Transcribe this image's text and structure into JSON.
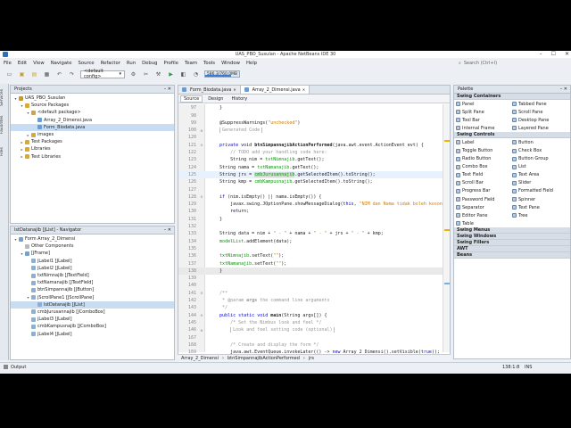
{
  "window": {
    "title": "UAS_PBO_Susulan - Apache NetBeans IDE 30"
  },
  "menu": [
    "File",
    "Edit",
    "View",
    "Navigate",
    "Source",
    "Refactor",
    "Run",
    "Debug",
    "Profile",
    "Team",
    "Tools",
    "Window",
    "Help"
  ],
  "search": {
    "placeholder": "Search (Ctrl+I)"
  },
  "toolbar": {
    "config": "<default config>",
    "memory": "586.3/760.0MB",
    "memory_fraction": 0.77
  },
  "projects": {
    "tab": "Projects",
    "nodes": [
      {
        "label": "UAS_PBO_Susulan",
        "depth": 0,
        "exp": "▾",
        "color": "#c59a2d"
      },
      {
        "label": "Source Packages",
        "depth": 1,
        "exp": "▾",
        "color": "#d6a93b"
      },
      {
        "label": "<default package>",
        "depth": 2,
        "exp": "▾",
        "color": "#c7a455"
      },
      {
        "label": "Array_2_Dimensi.java",
        "depth": 3,
        "exp": "",
        "color": "#6c9bd2"
      },
      {
        "label": "Form_Biodata.java",
        "depth": 3,
        "exp": "",
        "color": "#6c9bd2",
        "selected": true
      },
      {
        "label": "images",
        "depth": 2,
        "exp": "▸",
        "color": "#d6a93b"
      },
      {
        "label": "Test Packages",
        "depth": 1,
        "exp": "▸",
        "color": "#d6a93b"
      },
      {
        "label": "Libraries",
        "depth": 1,
        "exp": "▸",
        "color": "#d6a93b"
      },
      {
        "label": "Test Libraries",
        "depth": 1,
        "exp": "▸",
        "color": "#d6a93b"
      }
    ]
  },
  "navigator": {
    "tab": "lstDatanajib [JList] - Navigator",
    "nodes": [
      {
        "label": "Form Array_2_Dimensi",
        "depth": 0,
        "exp": "▾",
        "color": "#7aa0c8"
      },
      {
        "label": "Other Components",
        "depth": 1,
        "exp": "",
        "color": "#b9b9b9"
      },
      {
        "label": "[JFrame]",
        "depth": 1,
        "exp": "▾",
        "color": "#7aa0c8"
      },
      {
        "label": "jLabel1 [JLabel]",
        "depth": 2,
        "exp": "",
        "color": "#8bb0d8"
      },
      {
        "label": "jLabel2 [JLabel]",
        "depth": 2,
        "exp": "",
        "color": "#8bb0d8"
      },
      {
        "label": "txtNimnajib [JTextField]",
        "depth": 2,
        "exp": "",
        "color": "#8bb0d8"
      },
      {
        "label": "txtNamanajib [JTextField]",
        "depth": 2,
        "exp": "",
        "color": "#8bb0d8"
      },
      {
        "label": "btnSimpannajib [JButton]",
        "depth": 2,
        "exp": "",
        "color": "#8bb0d8"
      },
      {
        "label": "jScrollPane1 [JScrollPane]",
        "depth": 2,
        "exp": "▾",
        "color": "#8bb0d8"
      },
      {
        "label": "lstDatanajib [JList]",
        "depth": 3,
        "exp": "",
        "color": "#8bb0d8",
        "selected": true
      },
      {
        "label": "cmbJurusannajib [JComboBox]",
        "depth": 2,
        "exp": "",
        "color": "#8bb0d8"
      },
      {
        "label": "jLabel3 [JLabel]",
        "depth": 2,
        "exp": "",
        "color": "#8bb0d8"
      },
      {
        "label": "cmbKampusnajib [JComboBox]",
        "depth": 2,
        "exp": "",
        "color": "#8bb0d8"
      },
      {
        "label": "jLabel4 [JLabel]",
        "depth": 2,
        "exp": "",
        "color": "#8bb0d8"
      }
    ]
  },
  "side_tabs": [
    "Services",
    "Favorites",
    "Files"
  ],
  "editor": {
    "tabs": [
      {
        "label": "Form_Biodata.java",
        "active": false
      },
      {
        "label": "Array_2_Dimensi.java",
        "active": true
      }
    ],
    "modes": [
      "Source",
      "Design",
      "History"
    ],
    "lines": [
      {
        "n": "97",
        "f": "",
        "html": "    }"
      },
      {
        "n": "98",
        "f": "",
        "html": ""
      },
      {
        "n": "99",
        "f": "",
        "html": "    @SuppressWarnings(<span class='st'>\"unchecked\"</span>)"
      },
      {
        "n": "100",
        "f": "+",
        "html": "    <span class='cm' style='border:1px solid #bbb;padding:0 2px'>Generated Code</span>"
      },
      {
        "n": "120",
        "f": "",
        "html": ""
      },
      {
        "n": "121",
        "f": "-",
        "html": "    <span class='kw'>private void</span> <b>btnSimpannajibActionPerformed</b>(java.awt.event.ActionEvent evt) {"
      },
      {
        "n": "122",
        "f": "",
        "html": "        <span class='cm'>// TODO add your handling code here:</span>"
      },
      {
        "n": "123",
        "f": "",
        "html": "        String nim = <span class='fld'>txtNimnajib</span>.getText();"
      },
      {
        "n": "124",
        "f": "",
        "html": "    String nama = <span class='fld'>txtNamanajib</span>.getText();"
      },
      {
        "n": "125",
        "f": "",
        "html": "    String jrs = <span class='fld' style='background:#d8d8d8'>cmbJurusannajib</span>.getSelectedItem().toString();",
        "hl": true
      },
      {
        "n": "126",
        "f": "",
        "html": "    String kmp = <span class='fld'>cmbKampusnajib</span>.getSelectedItem().toString();"
      },
      {
        "n": "127",
        "f": "",
        "html": ""
      },
      {
        "n": "128",
        "f": "-",
        "html": "    <span class='kw'>if</span> (nim.isEmpty() || nama.isEmpty()) {"
      },
      {
        "n": "129",
        "f": "",
        "html": "        javax.swing.JOptionPane.showMessageDialog(<span class='kw'>this</span>, <span class='st'>\"NIM dan Nama tidak boleh kosong\"</span>);"
      },
      {
        "n": "130",
        "f": "",
        "html": "        <span class='kw'>return</span>;"
      },
      {
        "n": "131",
        "f": "",
        "html": "    }"
      },
      {
        "n": "132",
        "f": "",
        "html": ""
      },
      {
        "n": "133",
        "f": "",
        "html": "    String data = nim + <span class='st'>\" - \"</span> + nama + <span class='st'>\" - \"</span> + jrs + <span class='st'>\" - \"</span> + kmp;"
      },
      {
        "n": "134",
        "f": "",
        "html": "    <span class='fld'>modelList</span>.addElement(data);"
      },
      {
        "n": "135",
        "f": "",
        "html": ""
      },
      {
        "n": "136",
        "f": "",
        "html": "    <span class='fld'>txtNimnajib</span>.setText(<span class='st'>\"\"</span>);"
      },
      {
        "n": "137",
        "f": "",
        "html": "    <span class='fld'>txtNamanajib</span>.setText(<span class='st'>\"\"</span>);"
      },
      {
        "n": "138",
        "f": "",
        "html": "    }",
        "cur": true
      },
      {
        "n": "139",
        "f": "",
        "html": ""
      },
      {
        "n": "140",
        "f": "",
        "html": ""
      },
      {
        "n": "141",
        "f": "-",
        "html": "    <span class='cm'>/**</span>"
      },
      {
        "n": "142",
        "f": "",
        "html": "    <span class='cm'> * @param <b>args</b> the command line arguments</span>"
      },
      {
        "n": "143",
        "f": "",
        "html": "    <span class='cm'> */</span>"
      },
      {
        "n": "144",
        "f": "-",
        "html": "    <span class='kw'>public static void</span> <b>main</b>(String args[]) {"
      },
      {
        "n": "145",
        "f": "",
        "html": "        <span class='cm'>/* Set the Nimbus look and feel */</span>"
      },
      {
        "n": "146",
        "f": "+",
        "html": "        <span class='cm' style='border:1px solid #bbb;padding:0 2px'>Look and feel setting code (optional)</span>"
      },
      {
        "n": "167",
        "f": "",
        "html": ""
      },
      {
        "n": "168",
        "f": "",
        "html": "        <span class='cm'>/* Create and display the form */</span>"
      },
      {
        "n": "169",
        "f": "",
        "html": "        java.awt.EventQueue.invokeLater(() -&gt; <span class='kw'>new</span> Array_2_Dimensi().setVisible(<span class='kw'>true</span>));"
      }
    ]
  },
  "palette": {
    "tab": "Palette",
    "groups": [
      {
        "name": "Swing Containers",
        "items": [
          "Panel",
          "Tabbed Pane",
          "Split Pane",
          "Scroll Pane",
          "Tool Bar",
          "Desktop Pane",
          "Internal Frame",
          "Layered Pane"
        ]
      },
      {
        "name": "Swing Controls",
        "items": [
          "Label",
          "Button",
          "Toggle Button",
          "Check Box",
          "Radio Button",
          "Button Group",
          "Combo Box",
          "List",
          "Text Field",
          "Text Area",
          "Scroll Bar",
          "Slider",
          "Progress Bar",
          "Formatted Field",
          "Password Field",
          "Spinner",
          "Separator",
          "Text Pane",
          "Editor Pane",
          "Tree",
          "Table"
        ]
      },
      {
        "name": "Swing Menus",
        "items": []
      },
      {
        "name": "Swing Windows",
        "items": []
      },
      {
        "name": "Swing Fillers",
        "items": []
      },
      {
        "name": "AWT",
        "items": []
      },
      {
        "name": "Beans",
        "items": []
      }
    ]
  },
  "breadcrumb": [
    "Array_2_Dimensi",
    "btnSimpannajibActionPerformed",
    "jrs"
  ],
  "status": {
    "output": "Output",
    "position": "138:1:8",
    "mode": "INS"
  }
}
